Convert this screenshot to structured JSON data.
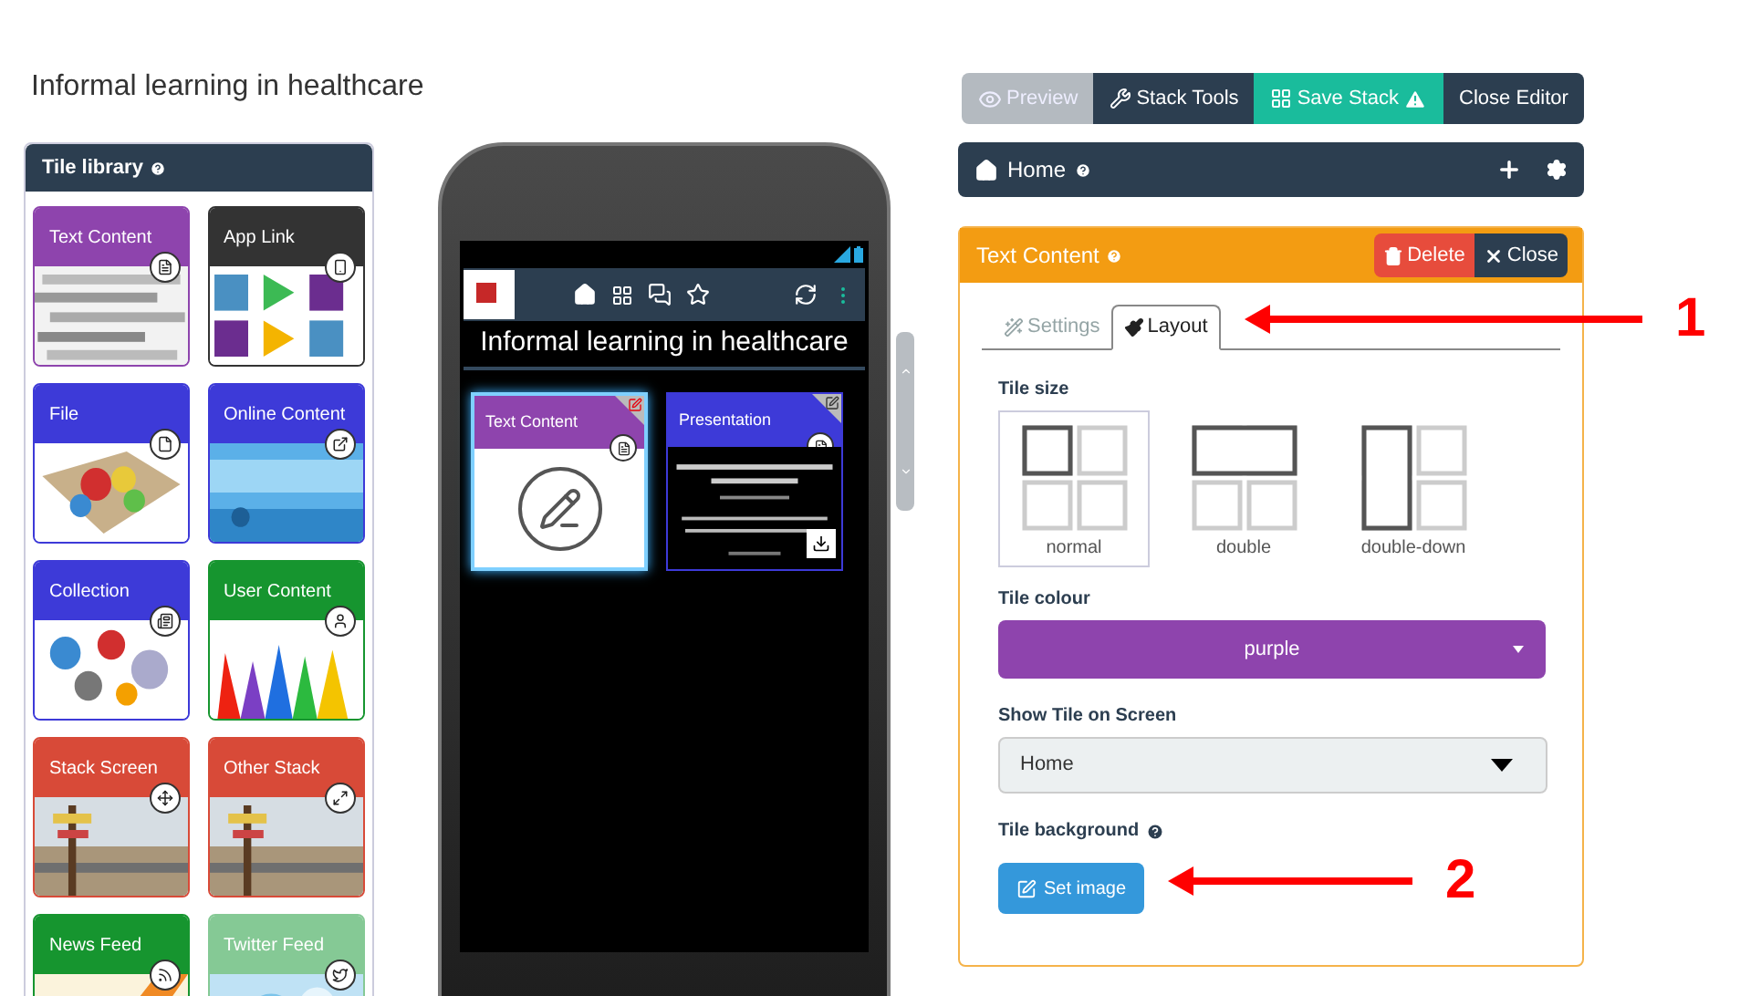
{
  "page_title": "Informal learning in healthcare",
  "tile_library": {
    "title": "Tile library",
    "tiles": [
      {
        "label": "Text Content",
        "color": "#8e44ad"
      },
      {
        "label": "App Link",
        "color": "#333333"
      },
      {
        "label": "File",
        "color": "#3d3ad8"
      },
      {
        "label": "Online Content",
        "color": "#3d3ad8"
      },
      {
        "label": "Collection",
        "color": "#3d3ad8"
      },
      {
        "label": "User Content",
        "color": "#16952f"
      },
      {
        "label": "Stack Screen",
        "color": "#d84a38"
      },
      {
        "label": "Other Stack",
        "color": "#d84a38"
      },
      {
        "label": "News Feed",
        "color": "#16952f"
      },
      {
        "label": "Twitter Feed",
        "color": "#85c995"
      }
    ]
  },
  "phone": {
    "screen_title": "Informal learning in healthcare",
    "tiles": [
      {
        "label": "Text Content",
        "color": "#8e44ad",
        "selected": true
      },
      {
        "label": "Presentation",
        "color": "#3d3ad8",
        "selected": false
      }
    ]
  },
  "toolbar": [
    {
      "label": "Preview",
      "kind": "preview"
    },
    {
      "label": "Stack Tools",
      "kind": "tools"
    },
    {
      "label": "Save Stack",
      "kind": "save"
    },
    {
      "label": "Close Editor",
      "kind": "close"
    }
  ],
  "screen_bar": {
    "title": "Home"
  },
  "editor": {
    "title": "Text Content",
    "buttons": [
      {
        "label": "Delete",
        "kind": "delete"
      },
      {
        "label": "Close",
        "kind": "close"
      }
    ],
    "tabs": [
      {
        "label": "Settings",
        "selected": false
      },
      {
        "label": "Layout",
        "selected": true
      }
    ],
    "tile_size": {
      "label": "Tile size",
      "options": [
        {
          "label": "normal",
          "selected": true
        },
        {
          "label": "double",
          "selected": false
        },
        {
          "label": "double-down",
          "selected": false
        }
      ]
    },
    "tile_colour": {
      "label": "Tile colour",
      "value": "purple",
      "color": "#8e44ad"
    },
    "show_on_screen": {
      "label": "Show Tile on Screen",
      "value": "Home"
    },
    "tile_background": {
      "label": "Tile background",
      "button": "Set image"
    }
  },
  "annotations": [
    {
      "label": "1"
    },
    {
      "label": "2"
    }
  ]
}
